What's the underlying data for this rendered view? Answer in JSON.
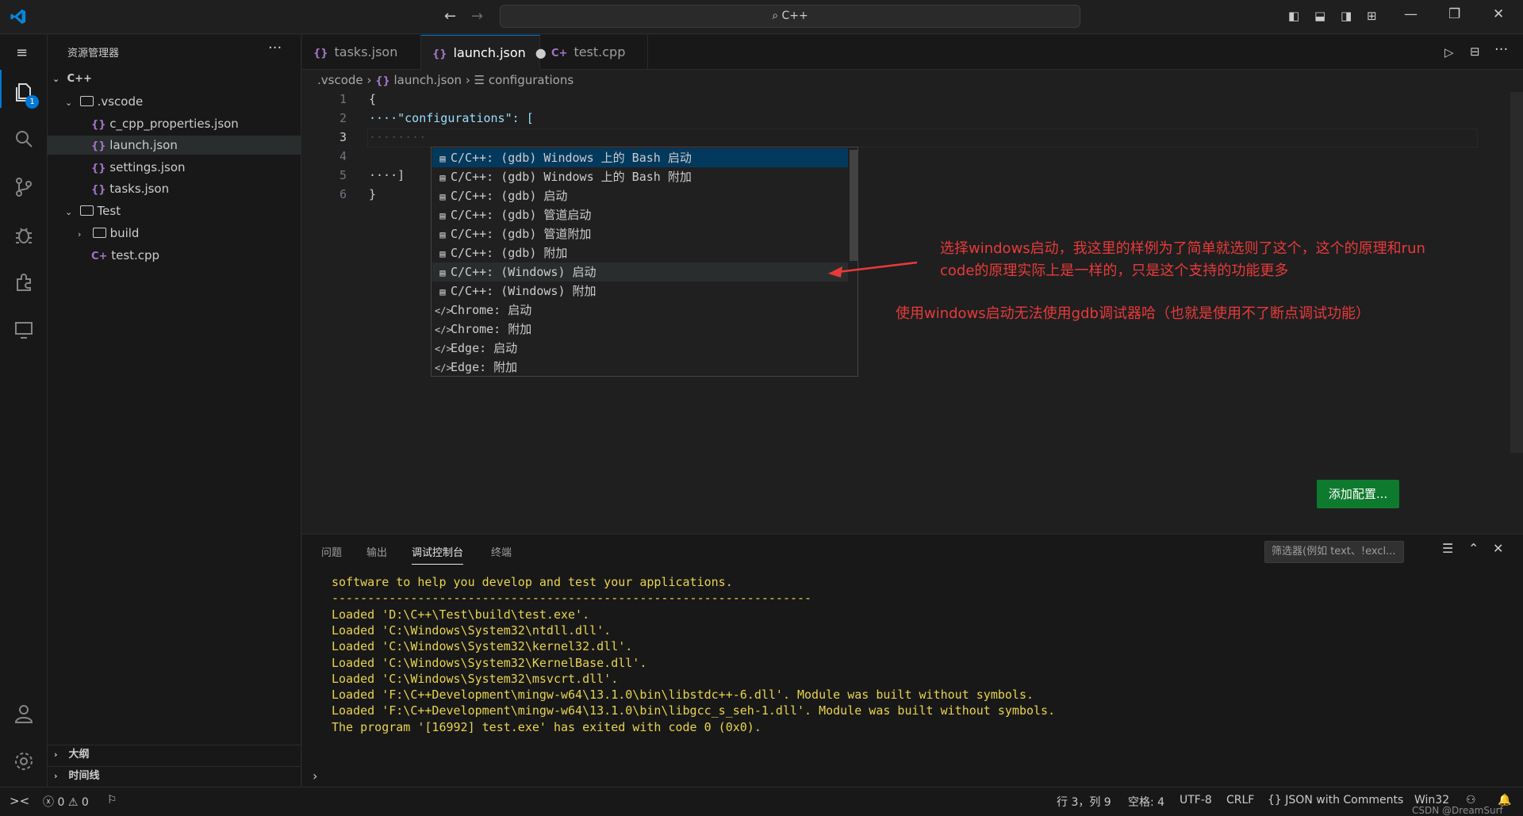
{
  "titlebar": {
    "search": "C++"
  },
  "sidebar": {
    "title": "资源管理器",
    "root": "C++",
    "folder_vscode": ".vscode",
    "files_vscode": [
      "c_cpp_properties.json",
      "launch.json",
      "settings.json",
      "tasks.json"
    ],
    "folder_test": "Test",
    "folder_build": "build",
    "file_test": "test.cpp",
    "outline": "大纲",
    "timeline": "时间线",
    "badge": "1"
  },
  "tabs": [
    {
      "label": "tasks.json"
    },
    {
      "label": "launch.json"
    },
    {
      "label": "test.cpp"
    }
  ],
  "breadcrumb": {
    "part1": ".vscode",
    "part2": "launch.json",
    "part3": "configurations"
  },
  "editor": {
    "lines": [
      {
        "n": "1",
        "text": "{"
      },
      {
        "n": "2",
        "text": "····\"configurations\": ["
      },
      {
        "n": "3",
        "text": "········"
      },
      {
        "n": "4",
        "text": ""
      },
      {
        "n": "5",
        "text": "····]"
      },
      {
        "n": "6",
        "text": "}"
      }
    ]
  },
  "suggestions": [
    "C/C++: (gdb) Windows 上的 Bash 启动",
    "C/C++: (gdb) Windows 上的 Bash 附加",
    "C/C++: (gdb) 启动",
    "C/C++: (gdb) 管道启动",
    "C/C++: (gdb) 管道附加",
    "C/C++: (gdb) 附加",
    "C/C++: (Windows) 启动",
    "C/C++: (Windows) 附加",
    "Chrome: 启动",
    "Chrome: 附加",
    "Edge: 启动",
    "Edge: 附加"
  ],
  "annotations": {
    "line1": "选择windows启动，我这里的样例为了简单就选则了这个，这个的原理和run",
    "line2": "code的原理实际上是一样的，只是这个支持的功能更多",
    "line3": "使用windows启动无法使用gdb调试器哈（也就是使用不了断点调试功能）"
  },
  "add_config": "添加配置...",
  "panel": {
    "tabs": [
      "问题",
      "输出",
      "调试控制台",
      "终端"
    ],
    "filter_placeholder": "筛选器(例如 text、!excl...",
    "console": [
      "software to help you develop and test your applications.",
      "-------------------------------------------------------------------",
      "Loaded 'D:\\C++\\Test\\build\\test.exe'.",
      "Loaded 'C:\\Windows\\System32\\ntdll.dll'.",
      "Loaded 'C:\\Windows\\System32\\kernel32.dll'.",
      "Loaded 'C:\\Windows\\System32\\KernelBase.dll'.",
      "Loaded 'C:\\Windows\\System32\\msvcrt.dll'.",
      "Loaded 'F:\\C++Development\\mingw-w64\\13.1.0\\bin\\libstdc++-6.dll'. Module was built without symbols.",
      "Loaded 'F:\\C++Development\\mingw-w64\\13.1.0\\bin\\libgcc_s_seh-1.dll'. Module was built without symbols.",
      "The program '[16992] test.exe' has exited with code 0 (0x0)."
    ],
    "prompt": "›"
  },
  "status": {
    "errors": "0",
    "warnings": "0",
    "position": "行 3，列 9",
    "spaces": "空格: 4",
    "encoding": "UTF-8",
    "eol": "CRLF",
    "language": "JSON with Comments",
    "platform": "Win32",
    "watermark": "CSDN @DreamSurf"
  }
}
